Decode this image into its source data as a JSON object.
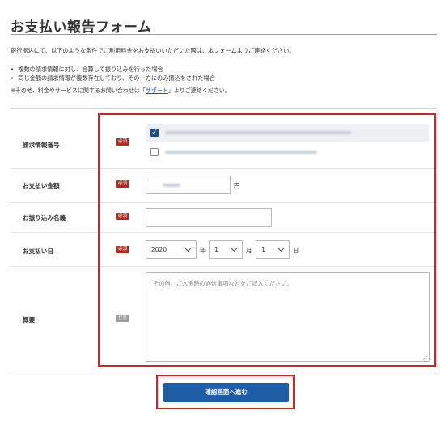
{
  "header": {
    "title": "お支払い報告フォーム"
  },
  "intro": {
    "text": "銀行振込にて、以下のような条件でご利用料金をお支払いいただいた際は、本フォームよりご連絡ください。",
    "bullets": [
      "複数の請求情報に対し、合算して振り込みを行った場合",
      "同じ金額の請求情報が複数存在しており、その一方にのみ振込をされた場合"
    ],
    "note_prefix": "※その他、料金やサービスに関するお問い合わせは「",
    "note_link": "サポート",
    "note_suffix": "」よりご連絡ください。"
  },
  "badges": {
    "required": "必須",
    "optional": "任意"
  },
  "form": {
    "billing": {
      "label": "請求情報番号",
      "options": [
        {
          "checked": true
        },
        {
          "checked": false
        }
      ]
    },
    "amount": {
      "label": "お支払い金額",
      "unit": "円"
    },
    "payer_name": {
      "label": "お振り込み名義",
      "value": ""
    },
    "payment_date": {
      "label": "お支払い日",
      "year": "2020",
      "year_unit": "年",
      "month": "1",
      "month_unit": "月",
      "day": "1",
      "day_unit": "日"
    },
    "summary": {
      "label": "概要",
      "placeholder": "その他、ご入金時の通信事項などをご記入ください。"
    }
  },
  "submit": {
    "label": "確認画面へ進む"
  },
  "colors": {
    "accent": "#1f5ca6",
    "required_badge": "#b12b22",
    "optional_badge": "#9c9c9c",
    "highlight_frame": "#d6211e",
    "checkbox": "#1d4b8f"
  }
}
